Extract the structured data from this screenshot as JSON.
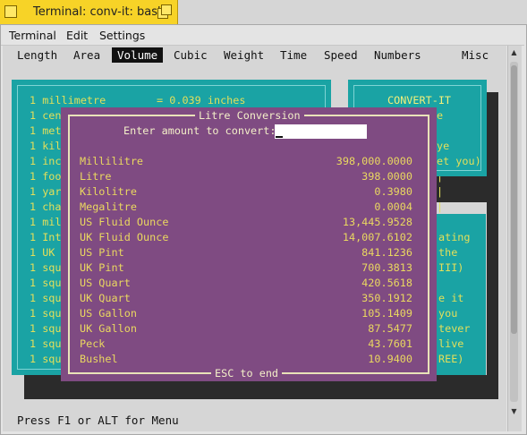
{
  "window": {
    "title": "Terminal: conv-it: bash"
  },
  "menubar": {
    "items": [
      "Terminal",
      "Edit",
      "Settings"
    ]
  },
  "tabs": [
    "Length",
    "Area",
    "Volume",
    "Cubic",
    "Weight",
    "Time",
    "Speed",
    "Numbers",
    "Misc"
  ],
  "active_tab": "Volume",
  "background_panel": {
    "lines": [
      "1 millimetre        = 0.039 inches",
      "1 cen",
      "1 met",
      "1 kil",
      "1 inc",
      "1 foo",
      "1 yar",
      "1 cha",
      "1 mil",
      "1 Int",
      "1 UK",
      "1 squ",
      "1 squ",
      "1 squ",
      "1 squ",
      "1 squ",
      "1 squ",
      "1 squ"
    ],
    "right_edge_fragments": [
      "|",
      "|",
      "|",
      "|",
      "|",
      "|",
      "|",
      "|",
      "|",
      "|",
      "|",
      "|",
      "|",
      "|",
      "|",
      "|",
      "|"
    ]
  },
  "convert_it_panel": {
    "title": "CONVERT-IT",
    "fragments": [
      "e",
      "",
      "ye",
      "et you)"
    ]
  },
  "side_panel_fragments": [
    "ating",
    "the",
    "III)",
    "",
    "e it",
    "you",
    "tever",
    "live",
    "REE)"
  ],
  "dialog": {
    "title": "Litre Conversion",
    "prompt": "Enter amount to convert:",
    "input_value": "",
    "footer": "ESC to end",
    "rows": [
      {
        "unit": "Millilitre",
        "value": "398,000.0000"
      },
      {
        "unit": "Litre",
        "value": "398.0000"
      },
      {
        "unit": "Kilolitre",
        "value": "0.3980"
      },
      {
        "unit": "Megalitre",
        "value": "0.0004"
      },
      {
        "unit": "US Fluid Ounce",
        "value": "13,445.9528"
      },
      {
        "unit": "UK Fluid Ounce",
        "value": "14,007.6102"
      },
      {
        "unit": "US Pint",
        "value": "841.1236"
      },
      {
        "unit": "UK Pint",
        "value": "700.3813"
      },
      {
        "unit": "US Quart",
        "value": "420.5618"
      },
      {
        "unit": "UK Quart",
        "value": "350.1912"
      },
      {
        "unit": "US Gallon",
        "value": "105.1409"
      },
      {
        "unit": "UK Gallon",
        "value": "87.5477"
      },
      {
        "unit": "Peck",
        "value": "43.7601"
      },
      {
        "unit": "Bushel",
        "value": "10.9400"
      }
    ]
  },
  "statusbar": {
    "text": "Press F1 or ALT for Menu"
  },
  "colors": {
    "titlebar": "#f7d327",
    "teal": "#1aa3a4",
    "dialog": "#7f4b82",
    "text_yellow": "#ead860"
  }
}
